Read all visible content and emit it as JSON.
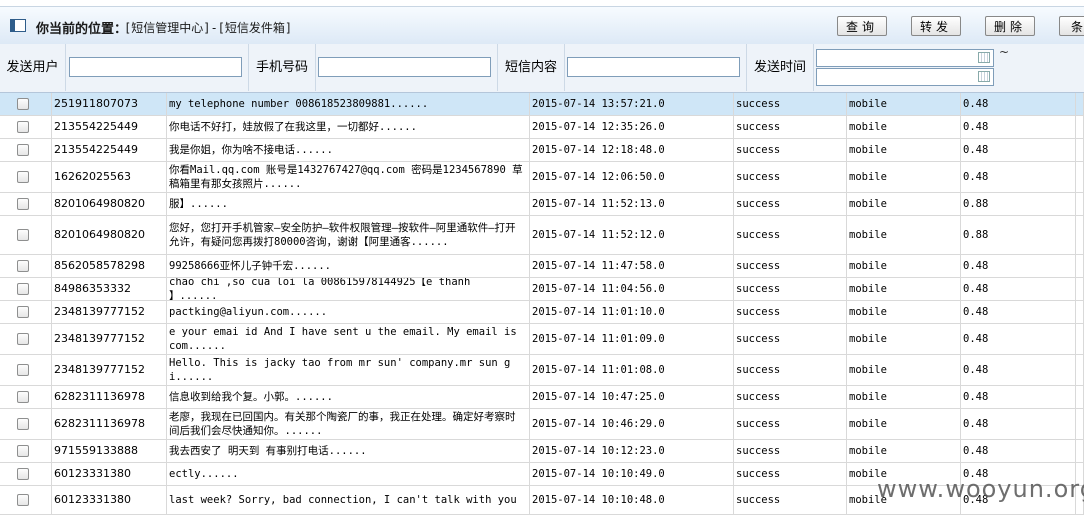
{
  "header": {
    "location_label": "你当前的位置：",
    "location_path": "[短信管理中心]-[短信发件箱]",
    "buttons": {
      "query": "查询",
      "forward": "转发",
      "delete": "删除",
      "more": "条"
    }
  },
  "filters": {
    "send_user_label": "发送用户",
    "phone_label": "手机号码",
    "content_label": "短信内容",
    "time_label": "发送时间",
    "range_sep": "~"
  },
  "messages": [
    {
      "phone": "251911807073",
      "content": "my telephone number 008618523809881......",
      "time": "2015-07-14 13:57:21.0",
      "status": "success",
      "type": "mobile",
      "fee": "0.48"
    },
    {
      "phone": "213554225449",
      "content": "你电话不好打，娃放假了在我这里，一切都好......",
      "time": "2015-07-14 12:35:26.0",
      "status": "success",
      "type": "mobile",
      "fee": "0.48"
    },
    {
      "phone": "213554225449",
      "content": "我是你姐，你为啥不接电话......",
      "time": "2015-07-14 12:18:48.0",
      "status": "success",
      "type": "mobile",
      "fee": "0.48"
    },
    {
      "phone": "16262025563",
      "content": "你看Mail.qq.com 账号是1432767427@qq.com 密码是1234567890 草稿箱里有那女孩照片......",
      "time": "2015-07-14 12:06:50.0",
      "status": "success",
      "type": "mobile",
      "fee": "0.48"
    },
    {
      "phone": "8201064980820",
      "content": "服】......",
      "time": "2015-07-14 11:52:13.0",
      "status": "success",
      "type": "mobile",
      "fee": "0.88"
    },
    {
      "phone": "8201064980820",
      "content": "您好，您打开手机管家—安全防护—软件权限管理—按软件—阿里通软件—打开允许，有疑问您再拨打80000咨询，谢谢【阿里通客......",
      "time": "2015-07-14 11:52:12.0",
      "status": "success",
      "type": "mobile",
      "fee": "0.88"
    },
    {
      "phone": "8562058578298",
      "content": "99258666亚怀儿子钟千宏......",
      "time": "2015-07-14 11:47:58.0",
      "status": "success",
      "type": "mobile",
      "fee": "0.48"
    },
    {
      "phone": "84986353332",
      "content": "chao chi ,so cua loi la 008615978144925【e thanh 】......",
      "time": "2015-07-14 11:04:56.0",
      "status": "success",
      "type": "mobile",
      "fee": "0.48"
    },
    {
      "phone": "2348139777152",
      "content": "pactking@aliyun.com......",
      "time": "2015-07-14 11:01:10.0",
      "status": "success",
      "type": "mobile",
      "fee": "0.48"
    },
    {
      "phone": "2348139777152",
      "content": "e your emai id And I have sent u the email. My email is com......",
      "time": "2015-07-14 11:01:09.0",
      "status": "success",
      "type": "mobile",
      "fee": "0.48"
    },
    {
      "phone": "2348139777152",
      "content": "Hello. This is jacky tao from mr sun' company.mr sun gi......",
      "time": "2015-07-14 11:01:08.0",
      "status": "success",
      "type": "mobile",
      "fee": "0.48"
    },
    {
      "phone": "6282311136978",
      "content": "信息收到给我个复。小郭。......",
      "time": "2015-07-14 10:47:25.0",
      "status": "success",
      "type": "mobile",
      "fee": "0.48"
    },
    {
      "phone": "6282311136978",
      "content": "老廖，我现在已回国内。有关那个陶瓷厂的事，我正在处理。确定好考察时间后我们会尽快通知你。......",
      "time": "2015-07-14 10:46:29.0",
      "status": "success",
      "type": "mobile",
      "fee": "0.48"
    },
    {
      "phone": "971559133888",
      "content": "我去西安了 明天到 有事别打电话......",
      "time": "2015-07-14 10:12:23.0",
      "status": "success",
      "type": "mobile",
      "fee": "0.48"
    },
    {
      "phone": "60123331380",
      "content": "ectly......",
      "time": "2015-07-14 10:10:49.0",
      "status": "success",
      "type": "mobile",
      "fee": "0.48"
    },
    {
      "phone": "60123331380",
      "content": "last week? Sorry, bad connection, I can't talk with you",
      "time": "2015-07-14 10:10:48.0",
      "status": "success",
      "type": "mobile",
      "fee": "0.48"
    }
  ],
  "watermark": "www.wooyun.org"
}
